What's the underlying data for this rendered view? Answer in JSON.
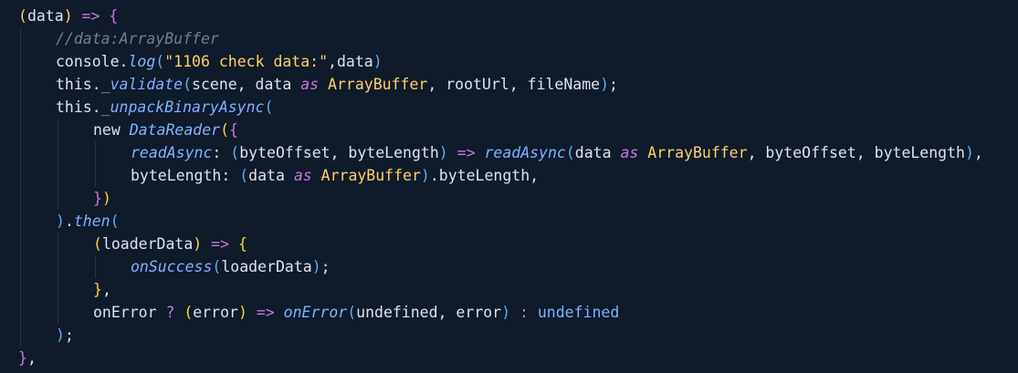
{
  "editor": {
    "lines": [
      {
        "indent": 0,
        "tokens": [
          {
            "text": "(",
            "cls": "tok-paren1"
          },
          {
            "text": "data",
            "cls": "tok-plain"
          },
          {
            "text": ")",
            "cls": "tok-paren1"
          },
          {
            "text": " => ",
            "cls": "tok-op"
          },
          {
            "text": "{",
            "cls": "tok-paren2"
          }
        ]
      },
      {
        "indent": 1,
        "tokens": [
          {
            "text": "//data:ArrayBuffer",
            "cls": "tok-comment"
          }
        ]
      },
      {
        "indent": 1,
        "tokens": [
          {
            "text": "console.",
            "cls": "tok-plain"
          },
          {
            "text": "log",
            "cls": "tok-function"
          },
          {
            "text": "(",
            "cls": "tok-paren3"
          },
          {
            "text": "\"1106 check data:\"",
            "cls": "tok-string"
          },
          {
            "text": ",",
            "cls": "tok-plain"
          },
          {
            "text": "data",
            "cls": "tok-plain"
          },
          {
            "text": ")",
            "cls": "tok-paren3"
          }
        ]
      },
      {
        "indent": 1,
        "tokens": [
          {
            "text": "this.",
            "cls": "tok-plain"
          },
          {
            "text": "_validate",
            "cls": "tok-function"
          },
          {
            "text": "(",
            "cls": "tok-paren3"
          },
          {
            "text": "scene, data ",
            "cls": "tok-plain"
          },
          {
            "text": "as",
            "cls": "tok-keyword-italic"
          },
          {
            "text": " ",
            "cls": "tok-plain"
          },
          {
            "text": "ArrayBuffer",
            "cls": "tok-type"
          },
          {
            "text": ", rootUrl, fileName",
            "cls": "tok-plain"
          },
          {
            "text": ")",
            "cls": "tok-paren3"
          },
          {
            "text": ";",
            "cls": "tok-plain"
          }
        ]
      },
      {
        "indent": 1,
        "tokens": [
          {
            "text": "this.",
            "cls": "tok-plain"
          },
          {
            "text": "_unpackBinaryAsync",
            "cls": "tok-function"
          },
          {
            "text": "(",
            "cls": "tok-paren3"
          }
        ]
      },
      {
        "indent": 2,
        "tokens": [
          {
            "text": "new ",
            "cls": "tok-plain"
          },
          {
            "text": "DataReader",
            "cls": "tok-function"
          },
          {
            "text": "(",
            "cls": "tok-paren1"
          },
          {
            "text": "{",
            "cls": "tok-paren2"
          }
        ]
      },
      {
        "indent": 3,
        "tokens": [
          {
            "text": "readAsync",
            "cls": "tok-function"
          },
          {
            "text": ": ",
            "cls": "tok-plain"
          },
          {
            "text": "(",
            "cls": "tok-paren3"
          },
          {
            "text": "byteOffset, byteLength",
            "cls": "tok-plain"
          },
          {
            "text": ")",
            "cls": "tok-paren3"
          },
          {
            "text": " => ",
            "cls": "tok-op"
          },
          {
            "text": "readAsync",
            "cls": "tok-function"
          },
          {
            "text": "(",
            "cls": "tok-paren3"
          },
          {
            "text": "data ",
            "cls": "tok-plain"
          },
          {
            "text": "as",
            "cls": "tok-keyword-italic"
          },
          {
            "text": " ",
            "cls": "tok-plain"
          },
          {
            "text": "ArrayBuffer",
            "cls": "tok-type"
          },
          {
            "text": ", byteOffset, byteLength",
            "cls": "tok-plain"
          },
          {
            "text": ")",
            "cls": "tok-paren3"
          },
          {
            "text": ",",
            "cls": "tok-plain"
          }
        ]
      },
      {
        "indent": 3,
        "tokens": [
          {
            "text": "byteLength",
            "cls": "tok-prop"
          },
          {
            "text": ": ",
            "cls": "tok-plain"
          },
          {
            "text": "(",
            "cls": "tok-paren3"
          },
          {
            "text": "data ",
            "cls": "tok-plain"
          },
          {
            "text": "as",
            "cls": "tok-keyword-italic"
          },
          {
            "text": " ",
            "cls": "tok-plain"
          },
          {
            "text": "ArrayBuffer",
            "cls": "tok-type"
          },
          {
            "text": ")",
            "cls": "tok-paren3"
          },
          {
            "text": ".byteLength,",
            "cls": "tok-plain"
          }
        ]
      },
      {
        "indent": 2,
        "tokens": [
          {
            "text": "}",
            "cls": "tok-paren2"
          },
          {
            "text": ")",
            "cls": "tok-paren1"
          }
        ]
      },
      {
        "indent": 1,
        "tokens": [
          {
            "text": ")",
            "cls": "tok-paren3"
          },
          {
            "text": ".",
            "cls": "tok-plain"
          },
          {
            "text": "then",
            "cls": "tok-function"
          },
          {
            "text": "(",
            "cls": "tok-paren3"
          }
        ]
      },
      {
        "indent": 2,
        "tokens": [
          {
            "text": "(",
            "cls": "tok-paren1"
          },
          {
            "text": "loaderData",
            "cls": "tok-plain"
          },
          {
            "text": ")",
            "cls": "tok-paren1"
          },
          {
            "text": " => ",
            "cls": "tok-op"
          },
          {
            "text": "{",
            "cls": "tok-paren1"
          }
        ]
      },
      {
        "indent": 3,
        "tokens": [
          {
            "text": "onSuccess",
            "cls": "tok-function"
          },
          {
            "text": "(",
            "cls": "tok-paren3"
          },
          {
            "text": "loaderData",
            "cls": "tok-plain"
          },
          {
            "text": ")",
            "cls": "tok-paren3"
          },
          {
            "text": ";",
            "cls": "tok-plain"
          }
        ]
      },
      {
        "indent": 2,
        "tokens": [
          {
            "text": "}",
            "cls": "tok-paren1"
          },
          {
            "text": ",",
            "cls": "tok-plain"
          }
        ]
      },
      {
        "indent": 2,
        "tokens": [
          {
            "text": "onError ",
            "cls": "tok-plain"
          },
          {
            "text": "?",
            "cls": "tok-op"
          },
          {
            "text": " ",
            "cls": "tok-plain"
          },
          {
            "text": "(",
            "cls": "tok-paren1"
          },
          {
            "text": "error",
            "cls": "tok-plain"
          },
          {
            "text": ")",
            "cls": "tok-paren1"
          },
          {
            "text": " => ",
            "cls": "tok-op"
          },
          {
            "text": "onError",
            "cls": "tok-function"
          },
          {
            "text": "(",
            "cls": "tok-paren3"
          },
          {
            "text": "undefined, error",
            "cls": "tok-plain"
          },
          {
            "text": ")",
            "cls": "tok-paren3"
          },
          {
            "text": " ",
            "cls": "tok-plain"
          },
          {
            "text": ":",
            "cls": "tok-op"
          },
          {
            "text": " ",
            "cls": "tok-plain"
          },
          {
            "text": "undefined",
            "cls": "tok-keyword"
          }
        ]
      },
      {
        "indent": 1,
        "tokens": [
          {
            "text": ")",
            "cls": "tok-paren3"
          },
          {
            "text": ";",
            "cls": "tok-plain"
          }
        ]
      },
      {
        "indent": 0,
        "tokens": [
          {
            "text": "}",
            "cls": "tok-paren2"
          },
          {
            "text": ",",
            "cls": "tok-plain"
          }
        ]
      }
    ]
  },
  "colors": {
    "background": "#0f1a2b",
    "indent_guide": "#243449"
  }
}
